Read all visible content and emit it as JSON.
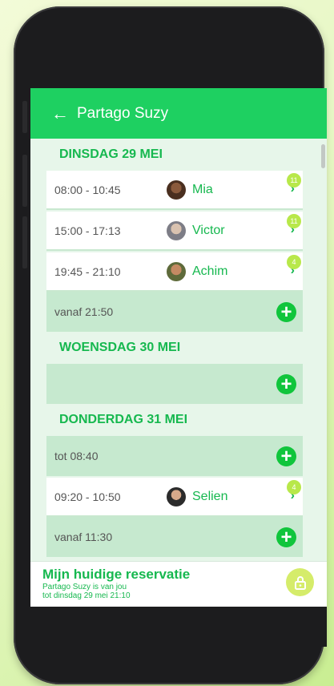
{
  "app": {
    "title": "Partago Suzy",
    "back_icon": "arrow-left-icon",
    "accent_color": "#1ed061"
  },
  "schedule": {
    "day1": {
      "label": "DINSDAG 29 MEI",
      "reservations": [
        {
          "time": "08:00 - 10:45",
          "name": "Mia",
          "badge": "11"
        },
        {
          "time": "15:00 - 17:13",
          "name": "Victor",
          "badge": "11"
        },
        {
          "time": "19:45 - 21:10",
          "name": "Achim",
          "badge": "4"
        }
      ],
      "free_after": "vanaf 21:50"
    },
    "day2": {
      "label": "WOENSDAG 30 MEI",
      "free": ""
    },
    "day3": {
      "label": "DONDERDAG 31 MEI",
      "free_before": "tot 08:40",
      "reservations": [
        {
          "time": "09:20 - 10:50",
          "name": "Selien",
          "badge": "4"
        }
      ],
      "free_after": "vanaf 11:30"
    }
  },
  "footer": {
    "title": "Mijn huidige reservatie",
    "line1": "Partago Suzy is van jou",
    "line2": "tot dinsdag 29 mei 21:10",
    "lock_icon": "lock-icon"
  },
  "icons": {
    "add": "+",
    "chevron": "›",
    "back": "←"
  }
}
